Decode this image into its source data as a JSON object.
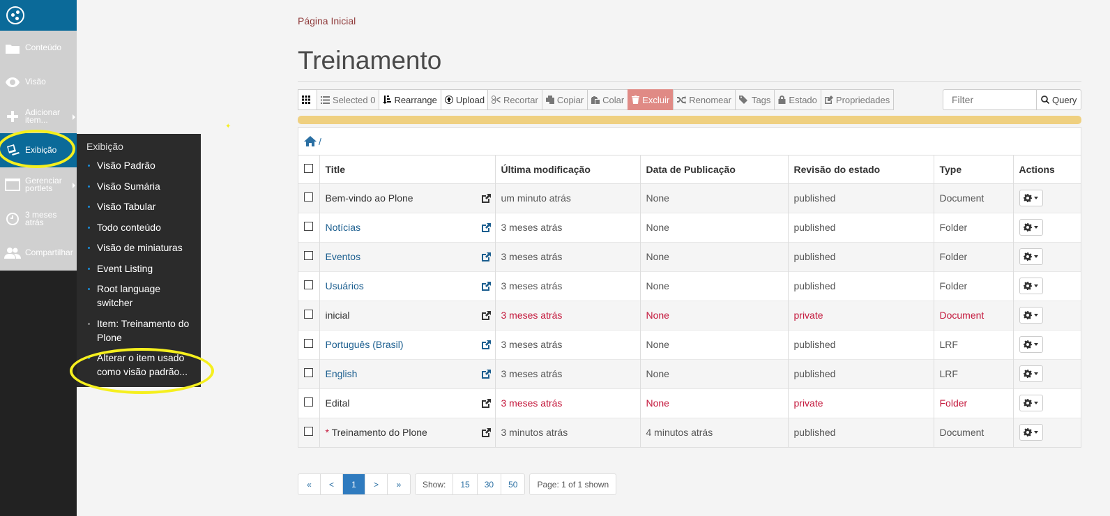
{
  "toolbar": {
    "items": [
      {
        "label": "Conteúdo",
        "icon": "folder-icon"
      },
      {
        "label": "Visão",
        "icon": "eye-icon"
      },
      {
        "label": "Adicionar item...",
        "icon": "plus-icon"
      },
      {
        "label": "Exibição",
        "icon": "display-icon"
      },
      {
        "label": "Gerenciar portlets",
        "icon": "portlets-icon"
      },
      {
        "label": "3 meses atrás",
        "icon": "clock-icon"
      },
      {
        "label": "Compartilhar",
        "icon": "users-icon"
      }
    ]
  },
  "submenu": {
    "title": "Exibição",
    "items": [
      "Visão Padrão",
      "Visão Sumária",
      "Visão Tabular",
      "Todo conteúdo",
      "Visão de miniaturas",
      "Event Listing",
      "Root language switcher",
      "Item: Treinamento do Plone",
      "Alterar o item usado como visão padrão..."
    ]
  },
  "breadcrumb": "Página Inicial",
  "page_title": "Treinamento",
  "buttons": {
    "selected": "Selected 0",
    "rearrange": "Rearrange",
    "upload": "Upload",
    "cut": "Recortar",
    "copy": "Copiar",
    "paste": "Colar",
    "delete": "Excluir",
    "rename": "Renomear",
    "tags": "Tags",
    "state": "Estado",
    "properties": "Propriedades",
    "query": "Query"
  },
  "filter_placeholder": "Filter",
  "path": "/",
  "columns": [
    "Title",
    "Última modificação",
    "Data de Publicação",
    "Revisão do estado",
    "Type",
    "Actions"
  ],
  "rows": [
    {
      "title": "Bem-vindo ao Plone",
      "modified": "um minuto atrás",
      "published": "None",
      "state": "published",
      "type": "Document"
    },
    {
      "title": "Notícias",
      "modified": "3 meses atrás",
      "published": "None",
      "state": "published",
      "type": "Folder"
    },
    {
      "title": "Eventos",
      "modified": "3 meses atrás",
      "published": "None",
      "state": "published",
      "type": "Folder"
    },
    {
      "title": "Usuários",
      "modified": "3 meses atrás",
      "published": "None",
      "state": "published",
      "type": "Folder"
    },
    {
      "title": "inicial",
      "modified": "3 meses atrás",
      "published": "None",
      "state": "private",
      "type": "Document"
    },
    {
      "title": "Português (Brasil)",
      "modified": "3 meses atrás",
      "published": "None",
      "state": "published",
      "type": "LRF"
    },
    {
      "title": "English",
      "modified": "3 meses atrás",
      "published": "None",
      "state": "published",
      "type": "LRF"
    },
    {
      "title": "Edital",
      "modified": "3 meses atrás",
      "published": "None",
      "state": "private",
      "type": "Folder"
    },
    {
      "title": "Treinamento do Plone",
      "modified": "3 minutos atrás",
      "published": "4 minutos atrás",
      "state": "published",
      "type": "Document"
    }
  ],
  "pagination": {
    "first": "«",
    "prev": "<",
    "current": "1",
    "next": ">",
    "last": "»",
    "show_label": "Show:",
    "sizes": [
      "15",
      "30",
      "50"
    ],
    "info": "Page: 1 of 1 shown"
  },
  "colors": {
    "accent": "#0b6a99",
    "private": "#c4183c",
    "highlight": "#f5ef1e",
    "danger": "#e08a85"
  }
}
